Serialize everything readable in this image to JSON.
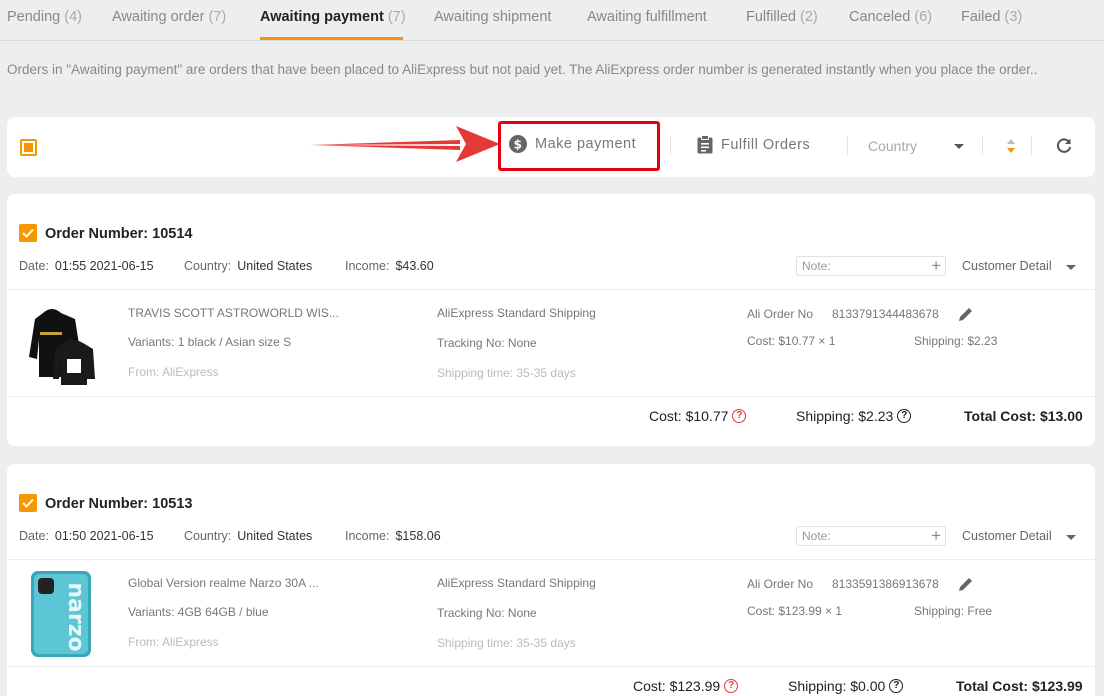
{
  "tabs": [
    {
      "label": "Pending",
      "count": "(4)"
    },
    {
      "label": "Awaiting order",
      "count": "(7)"
    },
    {
      "label": "Awaiting payment",
      "count": "(7)"
    },
    {
      "label": "Awaiting shipment",
      "count": ""
    },
    {
      "label": "Awaiting fulfillment",
      "count": ""
    },
    {
      "label": "Fulfilled",
      "count": "(2)"
    },
    {
      "label": "Canceled",
      "count": "(6)"
    },
    {
      "label": "Failed",
      "count": "(3)"
    }
  ],
  "description": "Orders in \"Awaiting payment\" are orders that have been placed to AliExpress but not paid yet. The AliExpress order number is generated instantly when you place the order..",
  "toolbar": {
    "make_payment": "Make payment",
    "fulfill_orders": "Fulfill Orders",
    "country_placeholder": "Country"
  },
  "orders": [
    {
      "number": "Order Number: 10514",
      "date_label": "Date:",
      "date": "01:55 2021-06-15",
      "country_label": "Country:",
      "country": "United States",
      "income_label": "Income:",
      "income": "$43.60",
      "note_placeholder": "Note:",
      "customer_detail": "Customer Detail",
      "product_title": "TRAVIS SCOTT ASTROWORLD WIS...",
      "variants": "Variants: 1 black / Asian size S",
      "from": "From: AliExpress",
      "shipping_method": "AliExpress Standard Shipping",
      "tracking": "Tracking No: None",
      "shipping_time": "Shipping time: 35-35 days",
      "ali_order_label": "Ali Order No",
      "ali_order_no": "8133791344483678",
      "item_cost": "Cost: $10.77 × 1",
      "item_shipping": "Shipping: $2.23",
      "foot_cost": "Cost: $10.77",
      "foot_shipping": "Shipping: $2.23",
      "foot_total": "Total Cost: $13.00"
    },
    {
      "number": "Order Number: 10513",
      "date_label": "Date:",
      "date": "01:50 2021-06-15",
      "country_label": "Country:",
      "country": "United States",
      "income_label": "Income:",
      "income": "$158.06",
      "note_placeholder": "Note:",
      "customer_detail": "Customer Detail",
      "product_title": "Global Version realme Narzo 30A ...",
      "variants": "Variants: 4GB 64GB / blue",
      "from": "From: AliExpress",
      "shipping_method": "AliExpress Standard Shipping",
      "tracking": "Tracking No: None",
      "shipping_time": "Shipping time: 35-35 days",
      "ali_order_label": "Ali Order No",
      "ali_order_no": "8133591386913678",
      "item_cost": "Cost: $123.99 × 1",
      "item_shipping": "Shipping: Free",
      "foot_cost": "Cost: $123.99",
      "foot_shipping": "Shipping: $0.00",
      "foot_total": "Total Cost: $123.99"
    }
  ],
  "colors": {
    "accent": "#f39800",
    "highlight": "#e60012",
    "background": "#eceef0"
  }
}
